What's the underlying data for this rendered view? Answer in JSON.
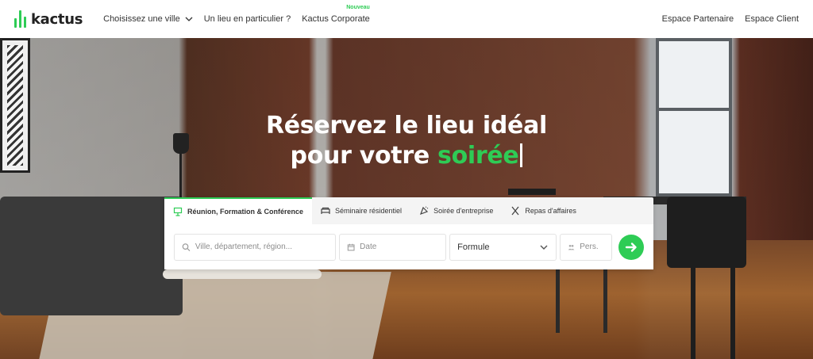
{
  "brand": {
    "name": "kactus",
    "color": "#2ecc55"
  },
  "nav": {
    "items": [
      {
        "label": "Choisissez une ville",
        "has_dropdown": true
      },
      {
        "label": "Un lieu en particulier ?"
      },
      {
        "label": "Kactus Corporate",
        "badge": "Nouveau"
      }
    ],
    "right": [
      {
        "label": "Espace Partenaire"
      },
      {
        "label": "Espace Client"
      }
    ]
  },
  "hero": {
    "headline_line1": "Réservez le lieu idéal",
    "headline_line2_prefix": "pour votre ",
    "headline_accent": "soirée"
  },
  "search": {
    "tabs": [
      {
        "label": "Réunion, Formation & Conférence",
        "icon": "presentation-board-icon",
        "active": true
      },
      {
        "label": "Séminaire résidentiel",
        "icon": "bed-icon",
        "active": false
      },
      {
        "label": "Soirée d'entreprise",
        "icon": "party-icon",
        "active": false
      },
      {
        "label": "Repas d'affaires",
        "icon": "utensils-icon",
        "active": false
      }
    ],
    "city_placeholder": "Ville, département, région...",
    "date_placeholder": "Date",
    "formule_value": "Formule",
    "pers_placeholder": "Pers.",
    "submit_icon": "arrow-right-icon"
  }
}
